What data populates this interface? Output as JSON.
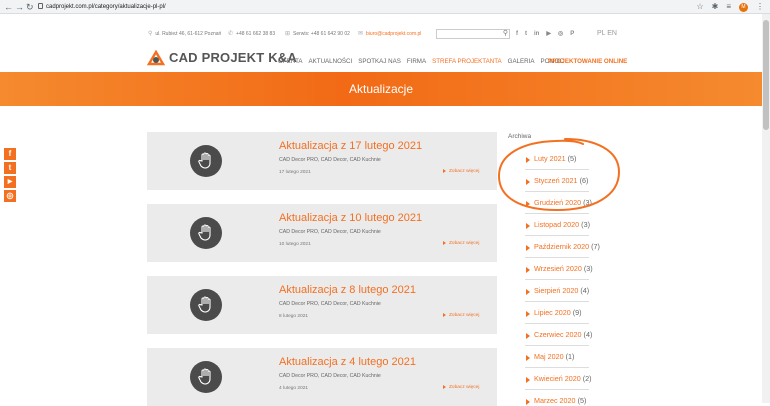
{
  "browser": {
    "url": "cadprojekt.com.pl/category/aktualizacje-pl-pl/",
    "avatar_letter": "M"
  },
  "topbar": {
    "address": "ul. Rubież 46, 61-612 Poznań",
    "phone": "+48 61 662 38 83",
    "service": "Serwis: +48 61 642 90 02",
    "email": "biuro@cadprojekt.com.pl",
    "lang": "PL EN",
    "search_placeholder": ""
  },
  "nav": {
    "brand": "CAD PROJEKT K&A",
    "items": [
      {
        "label": "OFERTA",
        "active": false
      },
      {
        "label": "AKTUALNOŚCI",
        "active": false
      },
      {
        "label": "SPOTKAJ NAS",
        "active": false
      },
      {
        "label": "FIRMA",
        "active": false
      },
      {
        "label": "STREFA PROJEKTANTA",
        "active": true
      },
      {
        "label": "GALERIA",
        "active": false
      },
      {
        "label": "POMOC",
        "active": false
      }
    ],
    "cta": "PROJEKTOWANIE ONLINE"
  },
  "banner": {
    "title": "Aktualizacje"
  },
  "posts": [
    {
      "title": "Aktualizacja z 17 lutego 2021",
      "tags": "CAD Decor PRO, CAD Decor, CAD Kuchnie",
      "date": "17 lutego 2021",
      "more": "Zobacz więcej"
    },
    {
      "title": "Aktualizacja z 10 lutego 2021",
      "tags": "CAD Decor PRO, CAD Decor, CAD Kuchnie",
      "date": "10 lutego 2021",
      "more": "Zobacz więcej"
    },
    {
      "title": "Aktualizacja z 8 lutego 2021",
      "tags": "CAD Decor PRO, CAD Decor, CAD Kuchnie",
      "date": "8 lutego 2021",
      "more": "Zobacz więcej"
    },
    {
      "title": "Aktualizacja z 4 lutego 2021",
      "tags": "CAD Decor PRO, CAD Decor, CAD Kuchnie",
      "date": "4 lutego 2021",
      "more": "Zobacz więcej"
    }
  ],
  "archive": {
    "title": "Archiwa",
    "items": [
      {
        "label": "Luty 2021",
        "count": "(5)"
      },
      {
        "label": "Styczeń 2021",
        "count": "(6)"
      },
      {
        "label": "Grudzień 2020",
        "count": "(3)"
      },
      {
        "label": "Listopad 2020",
        "count": "(3)"
      },
      {
        "label": "Październik 2020",
        "count": "(7)"
      },
      {
        "label": "Wrzesień 2020",
        "count": "(3)"
      },
      {
        "label": "Sierpień 2020",
        "count": "(4)"
      },
      {
        "label": "Lipiec 2020",
        "count": "(9)"
      },
      {
        "label": "Czerwiec 2020",
        "count": "(4)"
      },
      {
        "label": "Maj 2020",
        "count": "(1)"
      },
      {
        "label": "Kwiecień 2020",
        "count": "(2)"
      },
      {
        "label": "Marzec 2020",
        "count": "(5)"
      }
    ]
  },
  "colors": {
    "accent": "#f37021",
    "post_bg": "#ebebeb",
    "thumb_bg": "#4b4b4b"
  }
}
